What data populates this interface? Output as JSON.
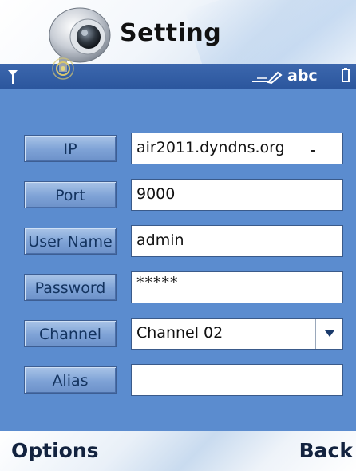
{
  "header": {
    "title": "Setting"
  },
  "status_bar": {
    "input_mode": "abc",
    "icons": [
      "signal-icon",
      "pen-icon",
      "battery-icon"
    ]
  },
  "form": {
    "ip": {
      "label": "IP",
      "value": "air2011.dyndns.org"
    },
    "port": {
      "label": "Port",
      "value": "9000"
    },
    "user_name": {
      "label": "User Name",
      "value": "admin"
    },
    "password": {
      "label": "Password",
      "value": "*****"
    },
    "channel": {
      "label": "Channel",
      "selected": "Channel 02"
    },
    "alias": {
      "label": "Alias",
      "value": ""
    }
  },
  "softkeys": {
    "left": "Options",
    "right": "Back"
  },
  "colors": {
    "panel": "#5b8ccf",
    "status_bar": "#2f5aa0",
    "label_button": "#7ea2d6",
    "label_text": "#13335f",
    "field_background": "#ffffff"
  }
}
